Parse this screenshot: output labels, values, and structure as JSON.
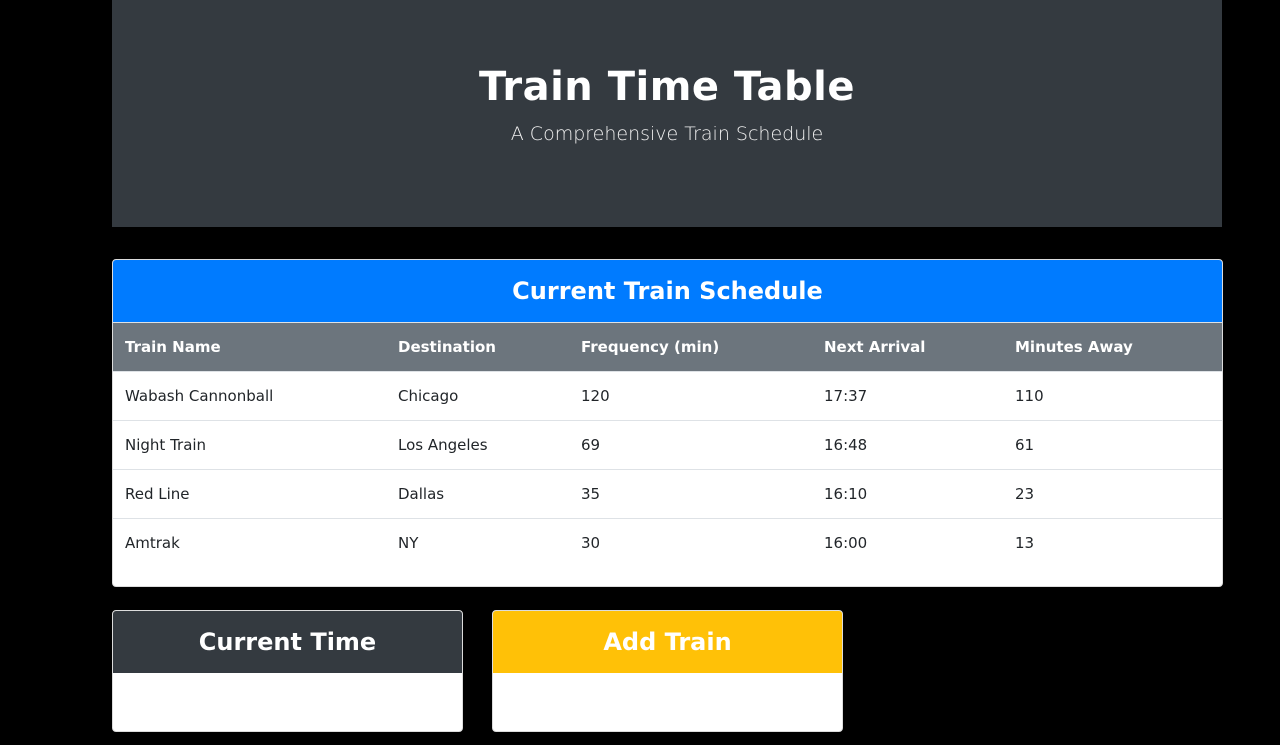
{
  "header": {
    "title": "Train Time Table",
    "subtitle": "A Comprehensive Train Schedule"
  },
  "schedule": {
    "title": "Current Train Schedule",
    "columns": [
      "Train Name",
      "Destination",
      "Frequency (min)",
      "Next Arrival",
      "Minutes Away"
    ],
    "rows": [
      [
        "Wabash Cannonball",
        "Chicago",
        "120",
        "17:37",
        "110"
      ],
      [
        "Night Train",
        "Los Angeles",
        "69",
        "16:48",
        "61"
      ],
      [
        "Red Line",
        "Dallas",
        "35",
        "16:10",
        "23"
      ],
      [
        "Amtrak",
        "NY",
        "30",
        "16:00",
        "13"
      ]
    ]
  },
  "current_time": {
    "title": "Current Time"
  },
  "add_train": {
    "title": "Add Train"
  },
  "colors": {
    "header_dark": "#343a40",
    "schedule_blue": "#007bff",
    "table_head_gray": "#6c757d",
    "add_yellow": "#ffc107"
  }
}
